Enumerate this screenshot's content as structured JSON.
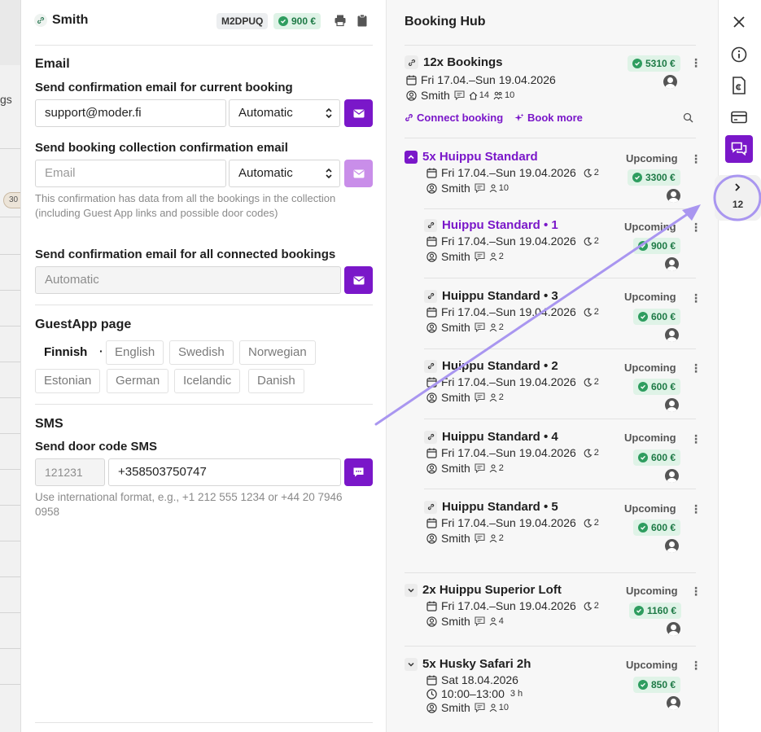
{
  "background": {
    "partial_label": "gs",
    "partial_count": "30"
  },
  "booking": {
    "guest": "Smith",
    "code": "M2DPUQ",
    "total": "900 €"
  },
  "email": {
    "section_title": "Email",
    "current": {
      "label": "Send confirmation email for current booking",
      "value": "support@moder.fi",
      "mode": "Automatic"
    },
    "collection": {
      "label": "Send booking collection confirmation email",
      "placeholder": "Email",
      "mode": "Automatic",
      "note": "This confirmation has data from all the bookings in the collection (including Guest App links and possible door codes)"
    },
    "connected": {
      "label": "Send confirmation email for all connected bookings",
      "value": "Automatic"
    }
  },
  "guestapp": {
    "title": "GuestApp page",
    "selected": "Finnish",
    "separator": "·",
    "languages": [
      "English",
      "Swedish",
      "Norwegian",
      "Estonian",
      "German",
      "Icelandic",
      "Danish"
    ]
  },
  "sms": {
    "title": "SMS",
    "label": "Send door code SMS",
    "code": "121231",
    "phone": "+358503750747",
    "note": "Use international format, e.g., +1 212 555 1234 or +44 20 7946 0958"
  },
  "hub": {
    "title": "Booking Hub",
    "group": {
      "title": "12x Bookings",
      "dates": "Fri 17.04.–Sun 19.04.2026",
      "guest": "Smith",
      "rooms": "14",
      "guests": "10",
      "total": "5310 €",
      "connect_label": "Connect booking",
      "book_more_label": "Book more"
    },
    "items": [
      {
        "title": "5x Huippu Standard",
        "dates": "Fri 17.04.–Sun 19.04.2026",
        "nights": "2",
        "guest": "Smith",
        "guests": "10",
        "status": "Upcoming",
        "price": "3300 €"
      },
      {
        "title": "Huippu Standard • 1",
        "dates": "Fri 17.04.–Sun 19.04.2026",
        "nights": "2",
        "guest": "Smith",
        "guests": "2",
        "status": "Upcoming",
        "price": "900 €"
      },
      {
        "title": "Huippu Standard • 3",
        "dates": "Fri 17.04.–Sun 19.04.2026",
        "nights": "2",
        "guest": "Smith",
        "guests": "2",
        "status": "Upcoming",
        "price": "600 €"
      },
      {
        "title": "Huippu Standard • 2",
        "dates": "Fri 17.04.–Sun 19.04.2026",
        "nights": "2",
        "guest": "Smith",
        "guests": "2",
        "status": "Upcoming",
        "price": "600 €"
      },
      {
        "title": "Huippu Standard • 4",
        "dates": "Fri 17.04.–Sun 19.04.2026",
        "nights": "2",
        "guest": "Smith",
        "guests": "2",
        "status": "Upcoming",
        "price": "600 €"
      },
      {
        "title": "Huippu Standard • 5",
        "dates": "Fri 17.04.–Sun 19.04.2026",
        "nights": "2",
        "guest": "Smith",
        "guests": "2",
        "status": "Upcoming",
        "price": "600 €"
      },
      {
        "title": "2x Huippu Superior Loft",
        "dates": "Fri 17.04.–Sun 19.04.2026",
        "nights": "2",
        "guest": "Smith",
        "guests": "4",
        "status": "Upcoming",
        "price": "1160 €"
      },
      {
        "title": "5x Husky Safari 2h",
        "date": "Sat 18.04.2026",
        "time": "10:00–13:00",
        "duration": "3 h",
        "guest": "Smith",
        "guests": "10",
        "status": "Upcoming",
        "price": "850 €"
      }
    ]
  },
  "rail": {
    "bookings_count": "12"
  },
  "colors": {
    "accent": "#7a17c9",
    "accent_light": "#c98ee9",
    "money_bg": "#dff3e7",
    "money_fg": "#1e7a46",
    "annotation": "#a996f0"
  }
}
